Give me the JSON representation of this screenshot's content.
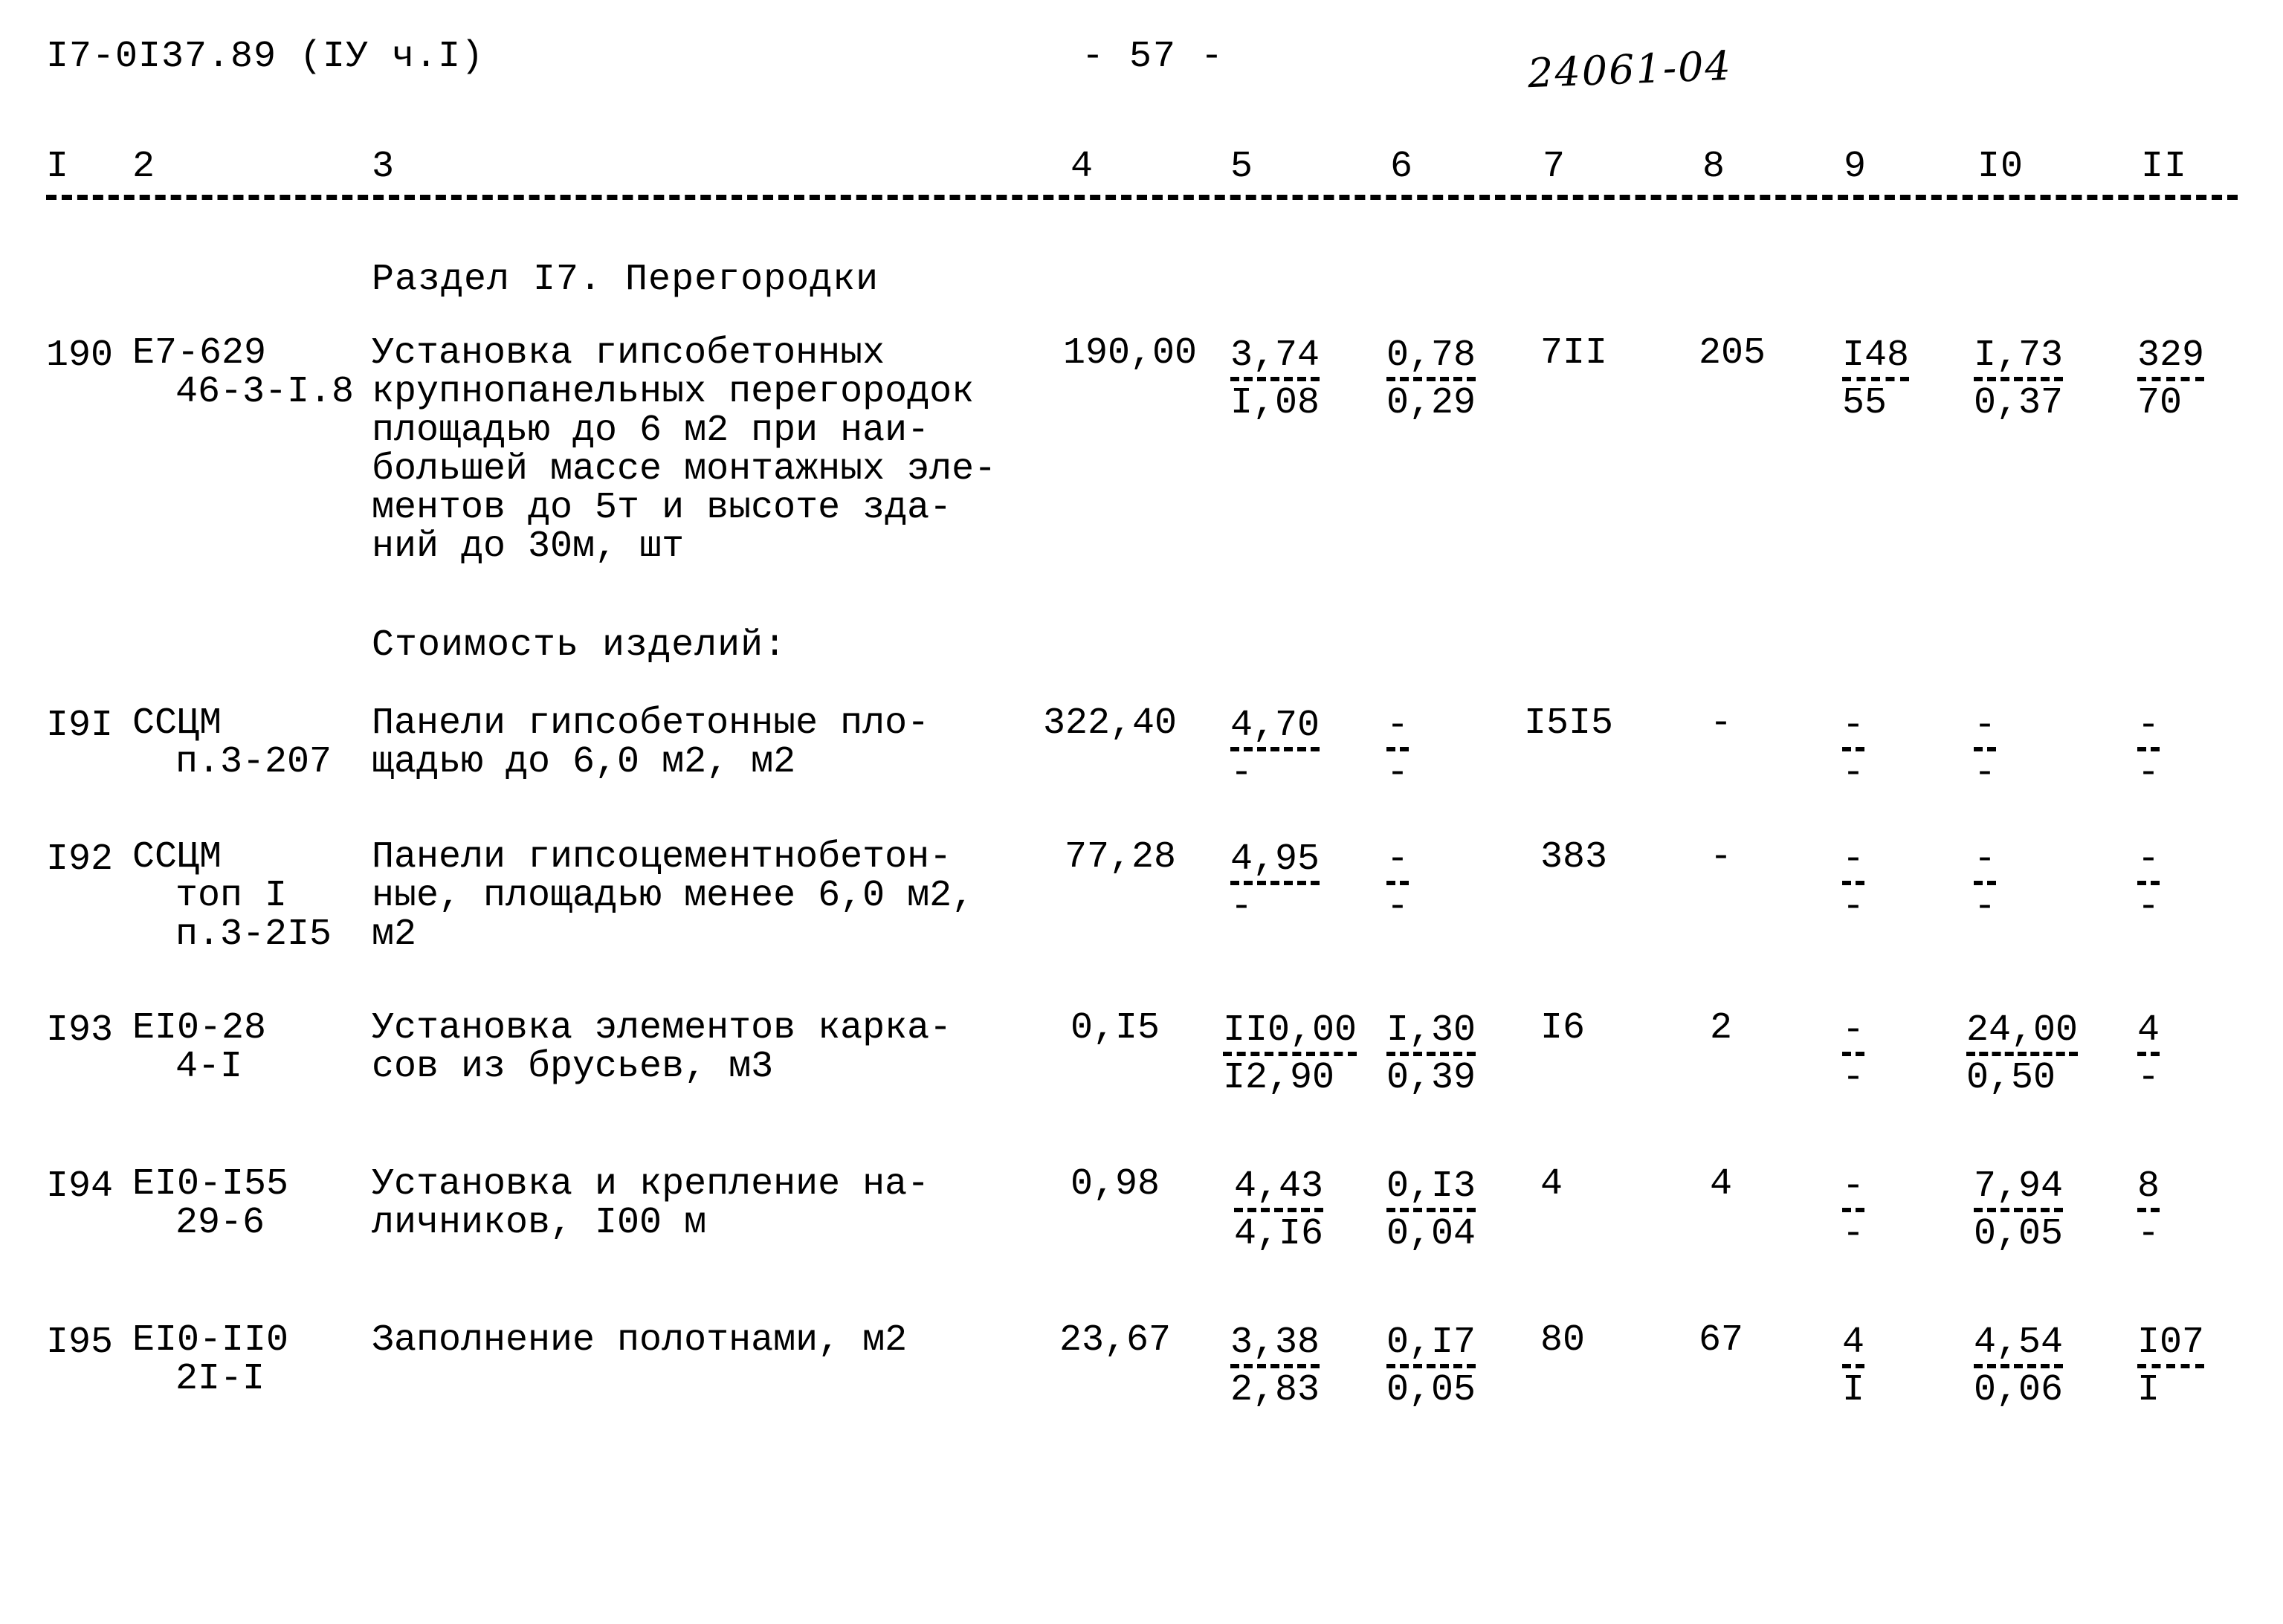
{
  "header": {
    "doc_code": "I7-0I37.89 (IУ ч.I)",
    "page_number": "- 57 -",
    "stamp": "24061-04"
  },
  "column_headers": [
    "I",
    "2",
    "3",
    "4",
    "5",
    "6",
    "7",
    "8",
    "9",
    "I0",
    "II"
  ],
  "section_heading": "Раздел I7. Перегородки",
  "sub_heading": "Стоимость изделий:",
  "rows": [
    {
      "num": "190",
      "code_lines": [
        "Е7-629",
        "46-3-I.8"
      ],
      "desc_lines": [
        "Установка гипсобетонных",
        "крупнопанельных перегородок",
        "площадью до 6 м2 при наи-",
        "большей массе монтажных эле-",
        "ментов до 5т и высоте зда-",
        "ний до 30м, шт"
      ],
      "c4": "190,00",
      "c5_top": "3,74",
      "c5_bot": "I,08",
      "c6_top": "0,78",
      "c6_bot": "0,29",
      "c7": "7II",
      "c8": "205",
      "c9_top": "I48",
      "c9_bot": "55",
      "c10_top": "I,73",
      "c10_bot": "0,37",
      "c11_top": "329",
      "c11_bot": "70"
    },
    {
      "num": "I9I",
      "code_lines": [
        "ССЦМ",
        "п.3-207"
      ],
      "desc_lines": [
        "Панели гипсобетонные пло-",
        "щадью до 6,0 м2, м2"
      ],
      "c4": "322,40",
      "c5_top": "4,70",
      "c5_bot": "-",
      "c6_top": "-",
      "c6_bot": "-",
      "c7": "I5I5",
      "c8": "-",
      "c9_top": "-",
      "c9_bot": "-",
      "c10_top": "-",
      "c10_bot": "-",
      "c11_top": "-",
      "c11_bot": "-"
    },
    {
      "num": "I92",
      "code_lines": [
        "ССЦМ",
        "топ I",
        "п.3-2I5"
      ],
      "desc_lines": [
        "Панели гипсоцементнобетон-",
        "ные, площадью менее 6,0 м2,",
        "м2"
      ],
      "c4": "77,28",
      "c5_top": "4,95",
      "c5_bot": "-",
      "c6_top": "-",
      "c6_bot": "-",
      "c7": "383",
      "c8": "-",
      "c9_top": "-",
      "c9_bot": "-",
      "c10_top": "-",
      "c10_bot": "-",
      "c11_top": "-",
      "c11_bot": "-"
    },
    {
      "num": "I93",
      "code_lines": [
        "ЕI0-28",
        "4-I"
      ],
      "desc_lines": [
        "Установка элементов карка-",
        "сов из брусьев, м3"
      ],
      "c4": "0,I5",
      "c5_top": "II0,00",
      "c5_bot": "I2,90",
      "c6_top": "I,30",
      "c6_bot": "0,39",
      "c7": "I6",
      "c8": "2",
      "c9_top": "-",
      "c9_bot": "-",
      "c10_top": "24,00",
      "c10_bot": "0,50",
      "c11_top": "4",
      "c11_bot": "-"
    },
    {
      "num": "I94",
      "code_lines": [
        "ЕI0-I55",
        "29-6"
      ],
      "desc_lines": [
        "Установка и крепление на-",
        "личников, I00 м"
      ],
      "c4": "0,98",
      "c5_top": "4,43",
      "c5_bot": "4,I6",
      "c6_top": "0,I3",
      "c6_bot": "0,04",
      "c7": "4",
      "c8": "4",
      "c9_top": "-",
      "c9_bot": "-",
      "c10_top": "7,94",
      "c10_bot": "0,05",
      "c11_top": "8",
      "c11_bot": "-"
    },
    {
      "num": "I95",
      "code_lines": [
        "ЕI0-II0",
        "2I-I"
      ],
      "desc_lines": [
        "Заполнение полотнами, м2"
      ],
      "c4": "23,67",
      "c5_top": "3,38",
      "c5_bot": "2,83",
      "c6_top": "0,I7",
      "c6_bot": "0,05",
      "c7": "80",
      "c8": "67",
      "c9_top": "4",
      "c9_bot": "I",
      "c10_top": "4,54",
      "c10_bot": "0,06",
      "c11_top": "I07",
      "c11_bot": "I"
    }
  ]
}
